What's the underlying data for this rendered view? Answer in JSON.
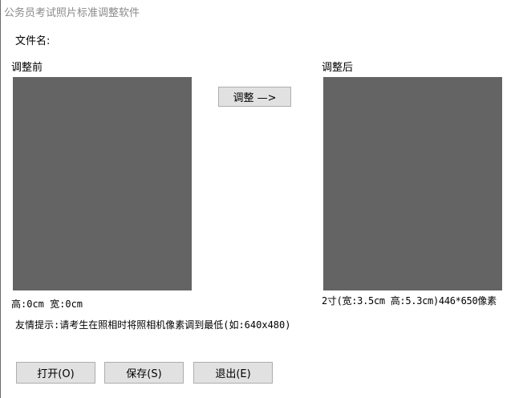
{
  "window": {
    "title": "公务员考试照片标准调整软件"
  },
  "file": {
    "label": "文件名:"
  },
  "before": {
    "label": "调整前",
    "dims": "高:0cm  宽:0cm"
  },
  "adjust_button": {
    "label": "调整 —>"
  },
  "after": {
    "label": "调整后",
    "spec": "2寸(宽:3.5cm 高:5.3cm)446*650像素"
  },
  "tip": {
    "text": "友情提示:请考生在照相时将照相机像素调到最低(如:640x480)"
  },
  "buttons": {
    "open": "打开(O)",
    "save": "保存(S)",
    "exit": "退出(E)"
  },
  "colors": {
    "photo_placeholder": "#646464",
    "button_face": "#e1e1e1",
    "title_text": "#8a8a8a"
  }
}
